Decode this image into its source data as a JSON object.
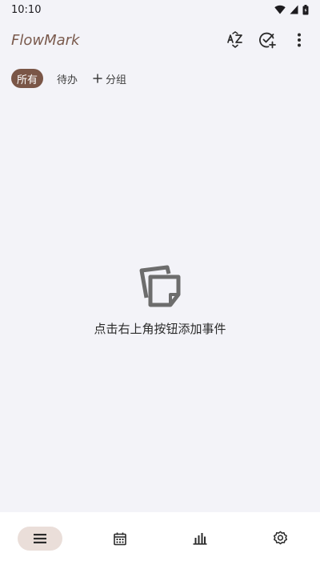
{
  "status_bar": {
    "time": "10:10",
    "icons": [
      "wifi-icon",
      "signal-icon",
      "battery-icon"
    ]
  },
  "app_bar": {
    "title": "FlowMark",
    "actions": [
      "sort-az-icon",
      "add-task-check-icon",
      "more-vert-icon"
    ]
  },
  "filters": {
    "chips": [
      {
        "label": "所有",
        "selected": true
      },
      {
        "label": "待办",
        "selected": false
      }
    ],
    "add_group_label": "分组"
  },
  "empty_state": {
    "icon": "notes-stack-icon",
    "message": "点击右上角按钮添加事件"
  },
  "bottom_nav": {
    "items": [
      {
        "icon": "list-icon",
        "selected": true
      },
      {
        "icon": "calendar-icon",
        "selected": false
      },
      {
        "icon": "bar-chart-icon",
        "selected": false
      },
      {
        "icon": "settings-gear-icon",
        "selected": false
      }
    ]
  },
  "colors": {
    "brand": "#7a5a4d",
    "chip_active_bg": "#7a5647",
    "nav_active_bg": "#eaded9",
    "background": "#f3f3f8"
  }
}
